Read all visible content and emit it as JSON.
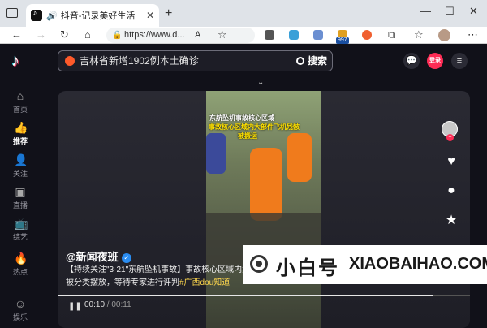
{
  "browser": {
    "tab_title": "抖音-记录美好生活",
    "url": "https://www.d...",
    "ext_badge": "997"
  },
  "app": {
    "search": {
      "query": "吉林省新增1902例本土确诊",
      "button": "搜索"
    },
    "login_label": "登录",
    "nav": [
      {
        "label": "首页",
        "icon": "home-icon"
      },
      {
        "label": "推荐",
        "icon": "thumbs-up-icon"
      },
      {
        "label": "关注",
        "icon": "user-add-icon"
      },
      {
        "label": "直播",
        "icon": "live-icon"
      },
      {
        "label": "综艺",
        "icon": "tv-icon"
      },
      {
        "label": "热点",
        "icon": "flame-icon"
      },
      {
        "label": "娱乐",
        "icon": "smile-icon"
      }
    ],
    "active_nav": "推荐",
    "video": {
      "caption_line1": "东航坠机事故核心区域",
      "caption_line2": "事故核心区域内大部件飞机残骸",
      "caption_line3": "被搬运",
      "author": "@新闻夜班",
      "verified_mark": "✓",
      "description": "【持续关注\"3·21\"东航坠机事故】事故核心区域内大部件飞机残骸，被搬运转移。现场清理出来的飞机残骸被分类摆放，等待专家进行评判",
      "hashtag": "#广西dou知道",
      "current_time": "00:10",
      "separator": " / ",
      "duration": "00:11",
      "progress": 0.91
    }
  },
  "watermark": {
    "cn": "小白号",
    "en": "XIAOBAIHAO.COM"
  },
  "colors": {
    "accent": "#fe2c55",
    "background": "#111119",
    "hashtag": "#ffd84d",
    "verified": "#2a8cf0"
  }
}
